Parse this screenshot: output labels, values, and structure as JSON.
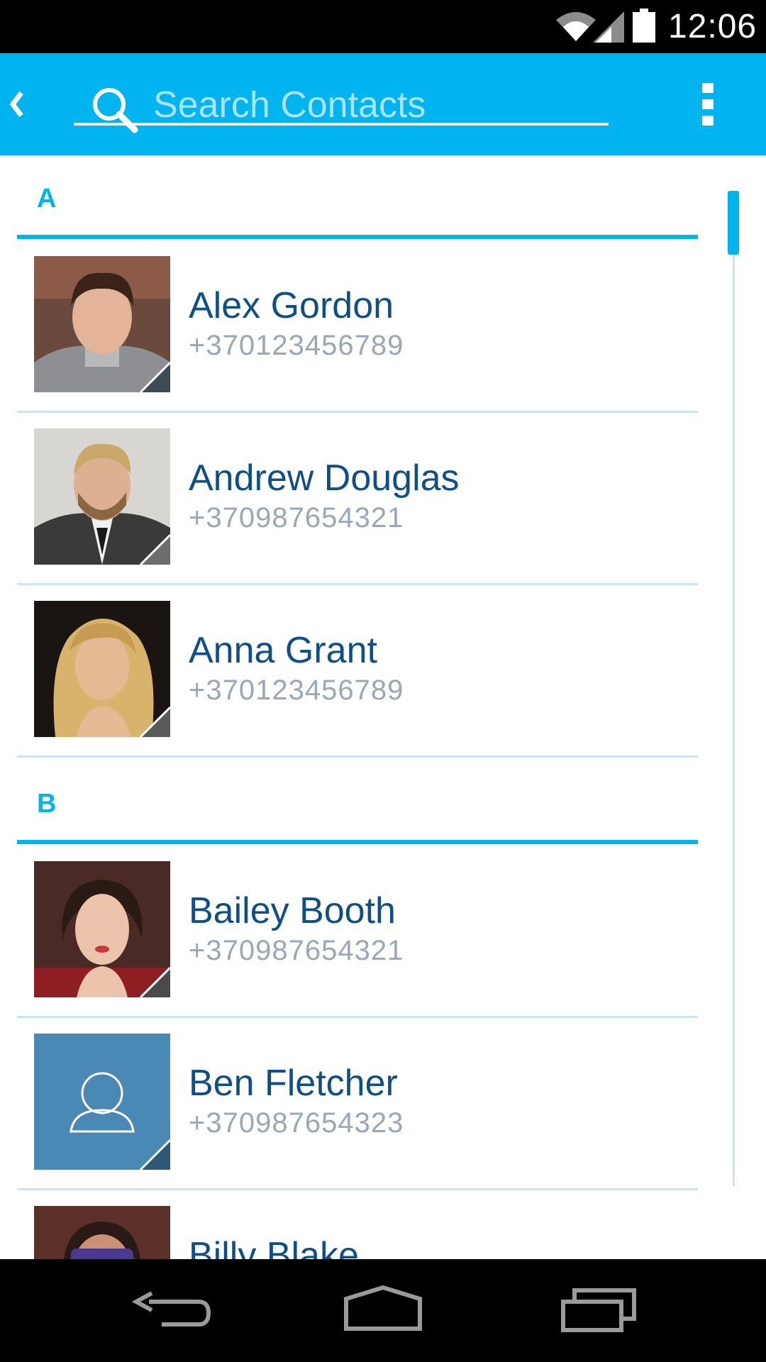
{
  "status_bar": {
    "time": "12:06",
    "icons": [
      "wifi-icon",
      "signal-icon",
      "battery-icon"
    ]
  },
  "action_bar": {
    "back_icon": "back-chevron-icon",
    "search_placeholder": "Search Contacts",
    "search_value": "",
    "menu_icon": "overflow-menu-icon"
  },
  "contacts": {
    "sections": [
      {
        "letter": "A",
        "items": [
          {
            "name": "Alex Gordon",
            "phone": "+370123456789",
            "avatar": "photo"
          },
          {
            "name": "Andrew Douglas",
            "phone": "+370987654321",
            "avatar": "photo"
          },
          {
            "name": "Anna Grant",
            "phone": "+370123456789",
            "avatar": "photo"
          }
        ]
      },
      {
        "letter": "B",
        "items": [
          {
            "name": "Bailey Booth",
            "phone": "+370987654321",
            "avatar": "photo"
          },
          {
            "name": "Ben Fletcher",
            "phone": "+370987654323",
            "avatar": "placeholder-person-icon"
          },
          {
            "name": "Billy Blake",
            "phone": "",
            "avatar": "photo"
          }
        ]
      }
    ]
  },
  "nav_bar": {
    "buttons": [
      "back-icon",
      "home-icon",
      "recents-icon"
    ]
  },
  "colors": {
    "accent": "#00b4f0",
    "name_text": "#0d4f86",
    "phone_text": "#9aa7b5",
    "divider": "#c6e6f4",
    "placeholder_avatar_bg": "#4a88b5"
  }
}
